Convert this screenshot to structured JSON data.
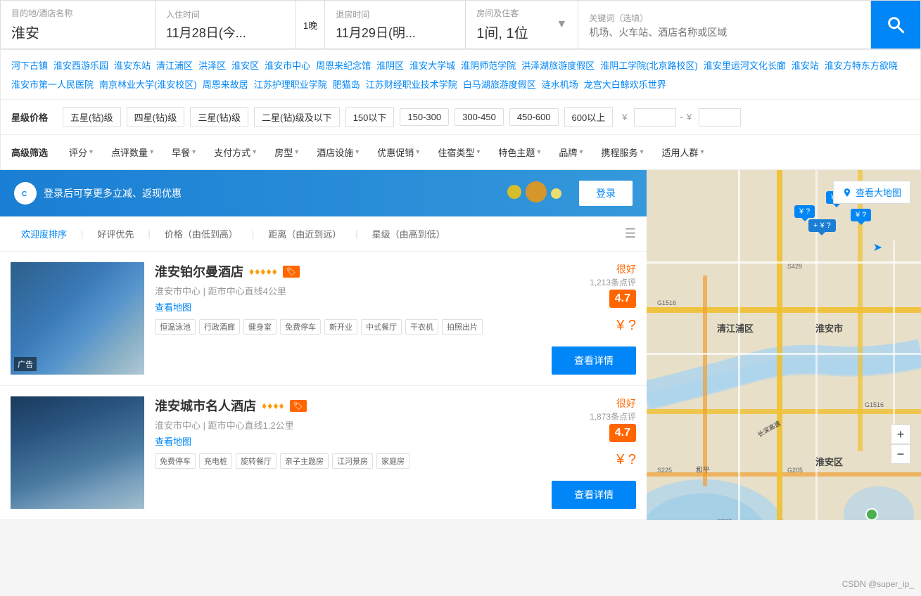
{
  "header": {
    "destination_label": "目的地/酒店名称",
    "destination_value": "淮安",
    "checkin_label": "入住时间",
    "checkin_value": "11月28日(今...",
    "nights_label": "1晚",
    "checkout_label": "退房时间",
    "checkout_value": "11月29日(明...",
    "rooms_label": "房间及住客",
    "rooms_value": "1间, 1位",
    "keyword_label": "关键词（选填）",
    "keyword_placeholder": "机场、火车站、酒店名称或区域",
    "search_btn_label": "🔍"
  },
  "location_tags": [
    "河下古镇",
    "淮安西游乐园",
    "淮安东站",
    "清江浦区",
    "洪泽区",
    "淮安区",
    "淮安市中心",
    "周恩来纪念馆",
    "淮阴区",
    "淮安大学城",
    "淮阴师范学院",
    "洪泽湖旅游度假区",
    "淮阴工学院(北京路校区)",
    "淮安里运河文化长廊",
    "淮安站",
    "淮安方特东方欲晓",
    "淮安市第一人民医院",
    "南京林业大学(淮安校区)",
    "周恩来故居",
    "江苏护理职业学院",
    "肥猫岛",
    "江苏财经职业技术学院",
    "白马湖旅游度假区",
    "涟水机场",
    "龙宫大白鲸欢乐世界"
  ],
  "star_price": {
    "label": "星级价格",
    "options": [
      "五星(钻)级",
      "四星(钻)级",
      "三星(钻)级",
      "二星(钻)级及以下",
      "150以下",
      "150-300",
      "300-450",
      "450-600",
      "600以上"
    ],
    "price_from_placeholder": "¥",
    "price_to_placeholder": "¥"
  },
  "advanced_filter": {
    "label": "高级筛选",
    "options": [
      "评分",
      "点评数量",
      "早餐",
      "支付方式",
      "房型",
      "酒店设施",
      "优惠促销",
      "住宿类型",
      "特色主题",
      "品牌",
      "携程服务",
      "适用人群"
    ]
  },
  "login_banner": {
    "text": "登录后可享更多立减、返现优惠",
    "btn_label": "登录"
  },
  "sort_bar": {
    "items": [
      "欢迎度排序",
      "好评优先",
      "价格（由低到高）",
      "距离（由近到远）",
      "星级（由高到低）"
    ]
  },
  "hotels": [
    {
      "name": "淮安铂尔曼酒店",
      "stars": 5,
      "badge": true,
      "location": "淮安市中心 | 距市中心直线4公里",
      "map_link": "查看地图",
      "amenities": [
        "恒温泳池",
        "行政酒廊",
        "健身室",
        "免费停车",
        "新开业",
        "中式餐厅",
        "干衣机",
        "拍照出片"
      ],
      "rating_text": "很好",
      "rating_count": "1,213条点评",
      "rating_score": "4.7",
      "price": "¥ ?",
      "detail_btn": "查看详情",
      "ad_label": "广告"
    },
    {
      "name": "淮安城市名人酒店",
      "stars": 4,
      "badge": true,
      "location": "淮安市中心 | 距市中心直线1.2公里",
      "map_link": "查看地图",
      "amenities": [
        "免费停车",
        "充电桩",
        "旋转餐厅",
        "亲子主题房",
        "江河景房",
        "家庭房"
      ],
      "rating_text": "很好",
      "rating_count": "1,873条点评",
      "rating_score": "4.7",
      "price": "¥ ?",
      "detail_btn": "查看详情",
      "ad_label": ""
    }
  ],
  "map": {
    "view_btn": "查看大地图",
    "zoom_in": "+",
    "zoom_out": "−",
    "price_pins": [
      "¥?",
      "¥?",
      "¥?"
    ],
    "labels": [
      "清江浦区",
      "淮安市",
      "淮安区"
    ],
    "watermark": "CSDN @super_ip_"
  }
}
